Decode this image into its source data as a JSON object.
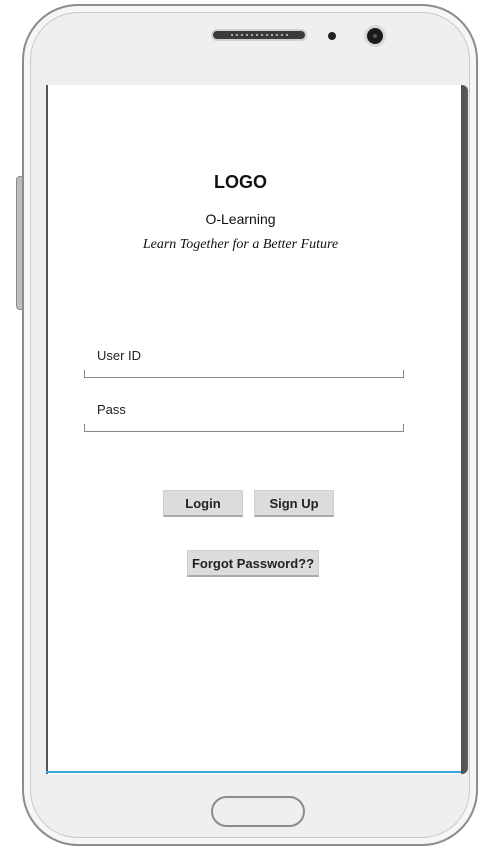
{
  "header": {
    "logo_text": "LOGO",
    "app_name": "O-Learning",
    "tagline": "Learn Together for a Better Future"
  },
  "form": {
    "user_id_label": "User ID",
    "pass_label": "Pass"
  },
  "buttons": {
    "login_label": "Login",
    "signup_label": "Sign Up",
    "forgot_label": "Forgot Password??"
  },
  "colors": {
    "screen_bottom_accent": "#3aa7d6",
    "button_bg": "#dcdcdc"
  }
}
